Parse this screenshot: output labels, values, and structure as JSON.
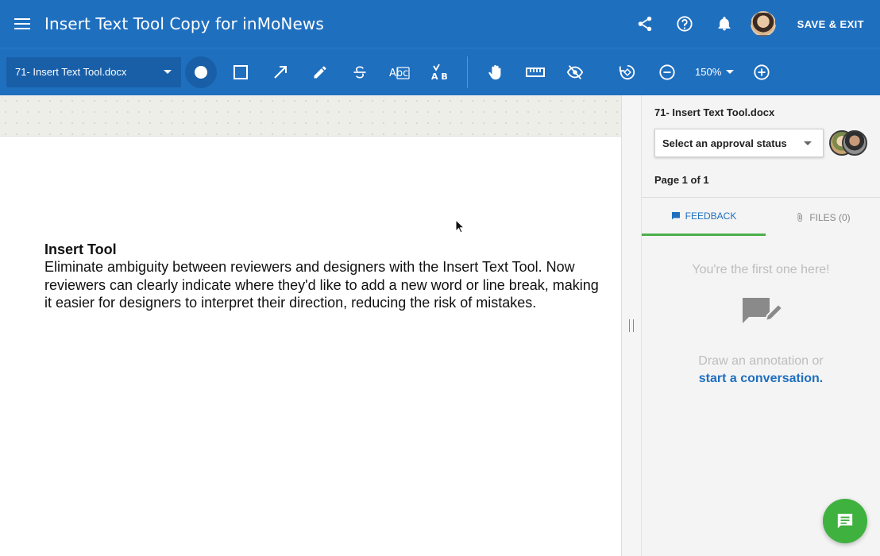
{
  "header": {
    "title": "Insert Text Tool Copy for inMoNews",
    "save_exit_label": "SAVE & EXIT"
  },
  "toolbar": {
    "file_name": "71- Insert Text Tool.docx",
    "zoom": "150%",
    "tools": [
      "record",
      "rectangle",
      "arrow",
      "pen",
      "strikethrough",
      "replace-text",
      "insert-text",
      "pan",
      "measure",
      "hide-annotations",
      "rotate",
      "zoom-out",
      "zoom-in"
    ]
  },
  "document": {
    "heading": "Insert Tool",
    "body": "Eliminate ambiguity between reviewers and designers with the Insert Text Tool. Now reviewers can clearly indicate where they'd like to add a new word or line break, making it easier for designers to interpret their direction, reducing the risk of mistakes."
  },
  "panel": {
    "file_name": "71- Insert Text Tool.docx",
    "approval_placeholder": "Select an approval status",
    "page_info": "Page 1 of 1",
    "tabs": [
      {
        "label": "FEEDBACK",
        "active": true
      },
      {
        "label": "FILES (0)",
        "active": false
      }
    ],
    "empty_title": "You're the first one here!",
    "empty_text": "Draw an annotation or",
    "empty_link": "start a conversation."
  },
  "colors": {
    "primary": "#1f6fbf",
    "toolbar_select": "#185fa8",
    "tab_indicator": "#4cae4c",
    "fab": "#3fb13f"
  }
}
